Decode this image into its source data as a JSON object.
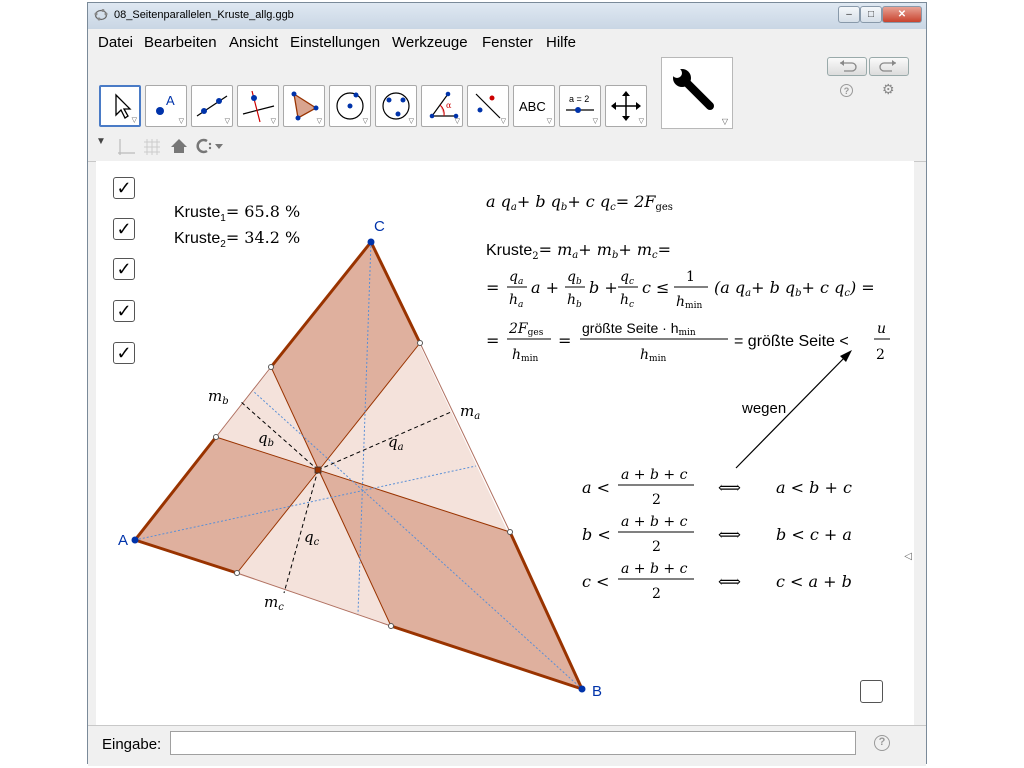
{
  "window": {
    "title": "08_Seitenparallelen_Kruste_allg.ggb"
  },
  "menu": [
    "Datei",
    "Bearbeiten",
    "Ansicht",
    "Einstellungen",
    "Werkzeuge",
    "Fenster",
    "Hilfe"
  ],
  "toolbar": {
    "tools": [
      "move-tool",
      "point-tool",
      "line-tool",
      "perpendicular-line-tool",
      "polygon-tool",
      "circle-tool",
      "circle-three-points-tool",
      "angle-tool",
      "reflect-tool",
      "text-tool",
      "slider-tool",
      "move-graphics-view-tool"
    ],
    "text_tool_label": "ABC",
    "slider_tool_label": "a = 2"
  },
  "labels": {
    "point_A": "A",
    "point_B": "B",
    "point_C": "C",
    "kruste1": "Kruste",
    "kruste1_sub": "1",
    "kruste1_val": "= 65.8 %",
    "kruste2": "Kruste",
    "kruste2_sub": "2",
    "kruste2_val": "= 34.2 %",
    "mb": "m",
    "mb_sub": "b",
    "ma": "m",
    "ma_sub": "a",
    "mc": "m",
    "mc_sub": "c",
    "qa": "q",
    "qa_sub": "a",
    "qb": "q",
    "qb_sub": "b",
    "qc": "q",
    "qc_sub": "c"
  },
  "formulas": {
    "f1_lhs": "a q",
    "f1_a": "a",
    "f1_b": "+ b q",
    "f1_bs": "b",
    "f1_c": "+ c q",
    "f1_cs": "c",
    "f1_eq": "= 2F",
    "f1_ges": "ges",
    "f2_lhs": "Kruste",
    "f2_sub": "2",
    "f2_rhs": "= m",
    "f2_a": "a",
    "f2_p1": "+ m",
    "f2_b": "b",
    "f2_p2": "+ m",
    "f2_c": "c",
    "f2_eq": "=",
    "f3_eq": "=",
    "f3_one": "1",
    "f3_hmin": "h",
    "f3_min": "min",
    "f3_rest": "(a q",
    "f3_rest_a": "a",
    "f3_rest2": "+ b q",
    "f3_rest_b": "b",
    "f3_rest3": "+ c q",
    "f3_rest_c": "c",
    "f3_end": ") =",
    "f4_eq": "=",
    "f4_num": "2F",
    "f4_ges": "ges",
    "f4_den": "h",
    "f4_min": "min",
    "f4_eq2": "=",
    "f4_num2": "größte Seite · h",
    "f4_num2_min": "min",
    "f4_den2": "h",
    "f4_den2_min": "min",
    "f4_eq3": "= größte Seite <",
    "f4_u": "u",
    "f4_2": "2",
    "wegen": "wegen",
    "i1_lhs": "a <",
    "i1_num": "a + b + c",
    "i1_den": "2",
    "i1_iff": "⟺",
    "i1_rhs": "a < b + c",
    "i2_lhs": "b <",
    "i2_num": "a + b + c",
    "i2_den": "2",
    "i2_iff": "⟺",
    "i2_rhs": "b < c + a",
    "i3_lhs": "c <",
    "i3_num": "a + b + c",
    "i3_den": "2",
    "i3_iff": "⟺",
    "i3_rhs": "c < a + b"
  },
  "frac_parts": {
    "qa": "q",
    "qa_s": "a",
    "ha": "h",
    "ha_s": "a",
    "pa": "a +",
    "qb": "q",
    "qb_s": "b",
    "hb": "h",
    "hb_s": "b",
    "pb": "b +",
    "qc": "q",
    "qc_s": "c",
    "hc": "h",
    "hc_s": "c",
    "pc": "c ≤"
  },
  "checkboxes": [
    true,
    true,
    true,
    true,
    true,
    false
  ],
  "input": {
    "label": "Eingabe:",
    "value": ""
  },
  "colors": {
    "accent": "#993300",
    "fill": "#d9a48f",
    "point": "#0033aa"
  }
}
